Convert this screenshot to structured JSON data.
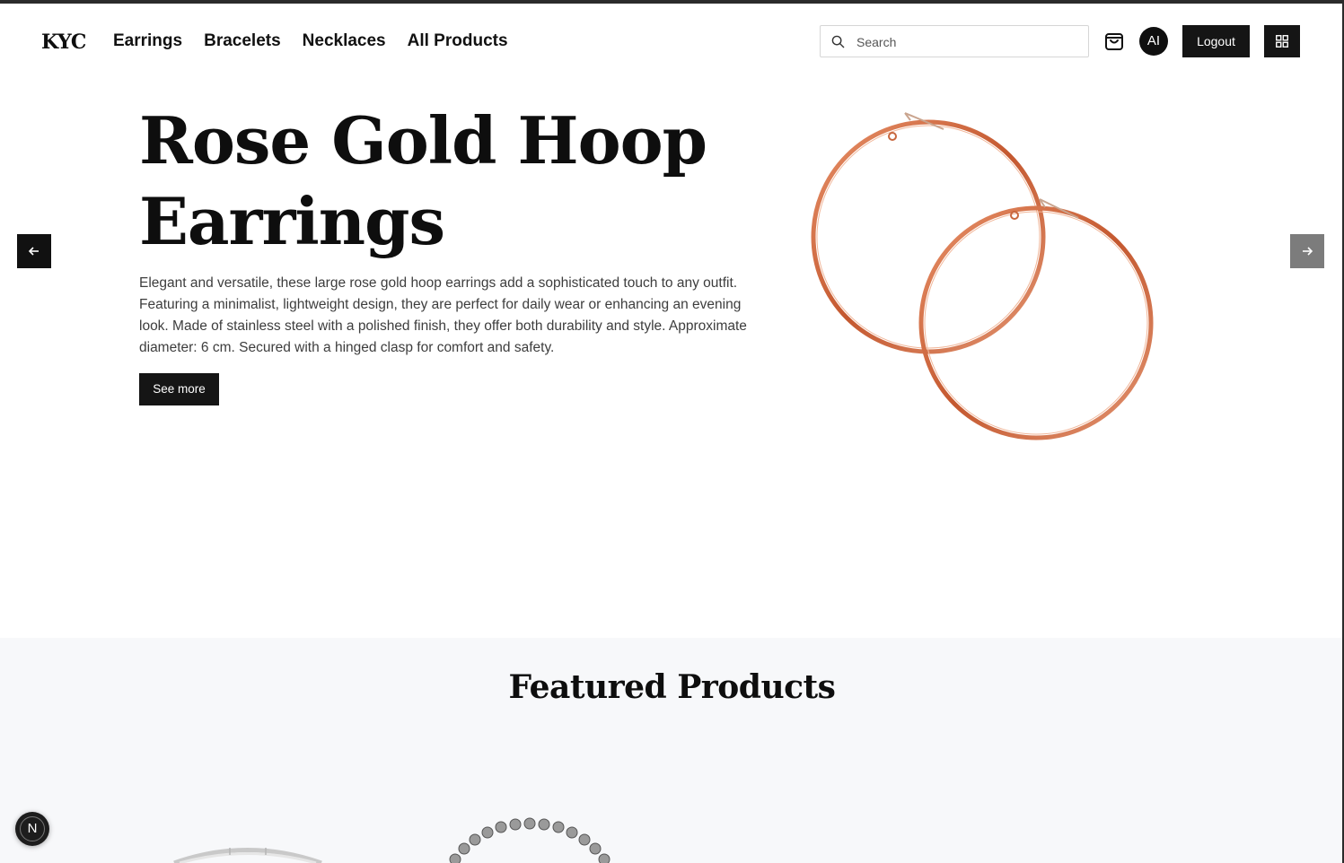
{
  "brand": {
    "logo_text": "KYC"
  },
  "nav": {
    "links": [
      "Earrings",
      "Bracelets",
      "Necklaces",
      "All Products"
    ]
  },
  "search": {
    "placeholder": "Search",
    "value": ""
  },
  "user": {
    "avatar_initials": "AI",
    "logout_label": "Logout"
  },
  "icons": {
    "search": "search-icon",
    "cart": "shopping-bag-icon",
    "apps": "grid-icon",
    "prev": "arrow-left-icon",
    "next": "arrow-right-icon"
  },
  "hero": {
    "title_line1": "Rose Gold Hoop",
    "title_line2": "Earrings",
    "description": "Elegant and versatile, these large rose gold hoop earrings add a sophisticated touch to any outfit. Featuring a minimalist, lightweight design, they are perfect for daily wear or enhancing an evening look. Made of stainless steel with a polished finish, they offer both durability and style. Approximate diameter: 6 cm. Secured with a hinged clasp for comfort and safety.",
    "cta_label": "See more",
    "image_alt": "rose-gold-hoop-earrings"
  },
  "featured": {
    "title": "Featured Products"
  },
  "dev_badge": {
    "label": "N"
  },
  "colors": {
    "primary": "#151515",
    "background": "#ffffff",
    "section_bg": "#f7f8fa",
    "rose_gold": "#c8673e",
    "next_arrow_bg": "#7c7c7c"
  }
}
